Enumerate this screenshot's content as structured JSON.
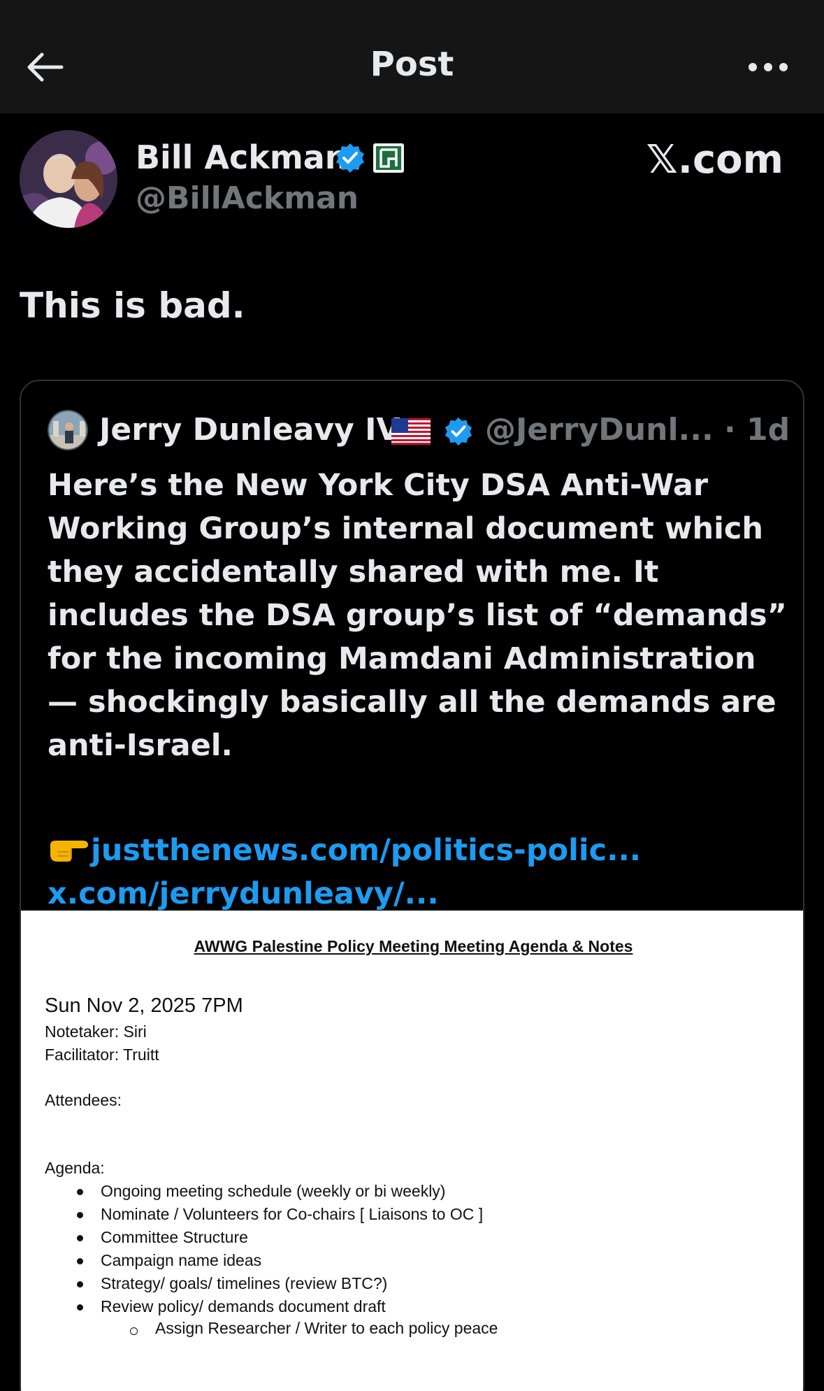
{
  "header": {
    "title": "Post"
  },
  "post": {
    "author_name": "Bill Ackman",
    "author_handle": "@BillAckman",
    "watermark": "𝕏.com",
    "text": "This is bad."
  },
  "quote": {
    "author_name": "Jerry Dunleavy IV",
    "author_handle": "@JerryDunl... · 1d",
    "body": "Here’s the New York City DSA Anti-War Working Group’s internal document which they accidentally shared with me. It includes the DSA group’s list of “demands” for the incoming Mamdani Administration — shockingly basically all the demands are anti-Israel.",
    "link1": "justthenews.com/politics-polic...",
    "link2": "x.com/jerrydunleavy/..."
  },
  "document": {
    "title": "AWWG Palestine Policy Meeting Meeting Agenda & Notes",
    "date": "Sun Nov 2, 2025 7PM",
    "notetaker": "Notetaker: Siri",
    "facilitator": "Facilitator: Truitt",
    "attendees": "Attendees:",
    "agenda_label": "Agenda:",
    "agenda_items": [
      "Ongoing meeting schedule (weekly or bi weekly)",
      "Nominate / Volunteers for Co-chairs [ Liaisons to OC ]",
      "Committee Structure",
      "Campaign name ideas",
      "Strategy/ goals/ timelines (review BTC?)"
    ],
    "agenda_item_6": "Review policy/ demands document draft",
    "sub_item": "Assign Researcher / Writer to each policy peace"
  },
  "colors": {
    "background": "#000000",
    "topbar": "#151515",
    "text": "#e7e9ea",
    "secondary": "#71767b",
    "link": "#1d9bf0",
    "verified": "#1d9bf0"
  }
}
